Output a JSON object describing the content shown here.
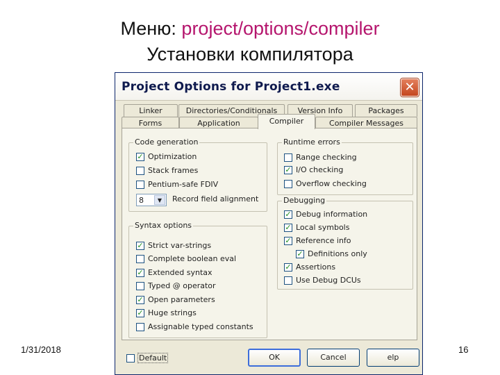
{
  "slide": {
    "title_line1_prefix": "Меню: ",
    "title_line1_accent": "project/options/compiler",
    "title_line2": "Установки компилятора",
    "date": "1/31/2018",
    "page_number": "16",
    "accent_color": "#b5156d"
  },
  "dialog": {
    "title": "Project Options for Project1.exe",
    "close_icon": "close-icon",
    "tabs_row1": [
      "Linker",
      "Directories/Conditionals",
      "Version Info",
      "Packages"
    ],
    "tabs_row2": [
      "Forms",
      "Application",
      "Compiler",
      "Compiler Messages"
    ],
    "active_tab": "Compiler",
    "code_generation": {
      "label": "Code generation",
      "items": [
        {
          "label": "Optimization",
          "checked": true
        },
        {
          "label": "Stack frames",
          "checked": false
        },
        {
          "label": "Pentium-safe FDIV",
          "checked": false
        }
      ],
      "alignment_value": "8",
      "alignment_label": "Record field alignment"
    },
    "syntax_options": {
      "label": "Syntax options",
      "items": [
        {
          "label": "Strict var-strings",
          "checked": true
        },
        {
          "label": "Complete boolean eval",
          "checked": false
        },
        {
          "label": "Extended syntax",
          "checked": true
        },
        {
          "label": "Typed @ operator",
          "checked": false
        },
        {
          "label": "Open parameters",
          "checked": true
        },
        {
          "label": "Huge strings",
          "checked": true
        },
        {
          "label": "Assignable typed constants",
          "checked": false
        }
      ]
    },
    "runtime_errors": {
      "label": "Runtime errors",
      "items": [
        {
          "label": "Range checking",
          "checked": false
        },
        {
          "label": "I/O checking",
          "checked": true
        },
        {
          "label": "Overflow checking",
          "checked": false
        }
      ]
    },
    "debugging": {
      "label": "Debugging",
      "items": [
        {
          "label": "Debug information",
          "checked": true
        },
        {
          "label": "Local symbols",
          "checked": true
        },
        {
          "label": "Reference info",
          "checked": true
        },
        {
          "label": "Definitions only",
          "checked": true
        },
        {
          "label": "Assertions",
          "checked": true
        },
        {
          "label": "Use Debug DCUs",
          "checked": false
        }
      ]
    },
    "footer": {
      "default_label": "Default",
      "default_checked": false,
      "ok_label": "OK",
      "cancel_label": "Cancel",
      "help_label": "elp"
    }
  }
}
